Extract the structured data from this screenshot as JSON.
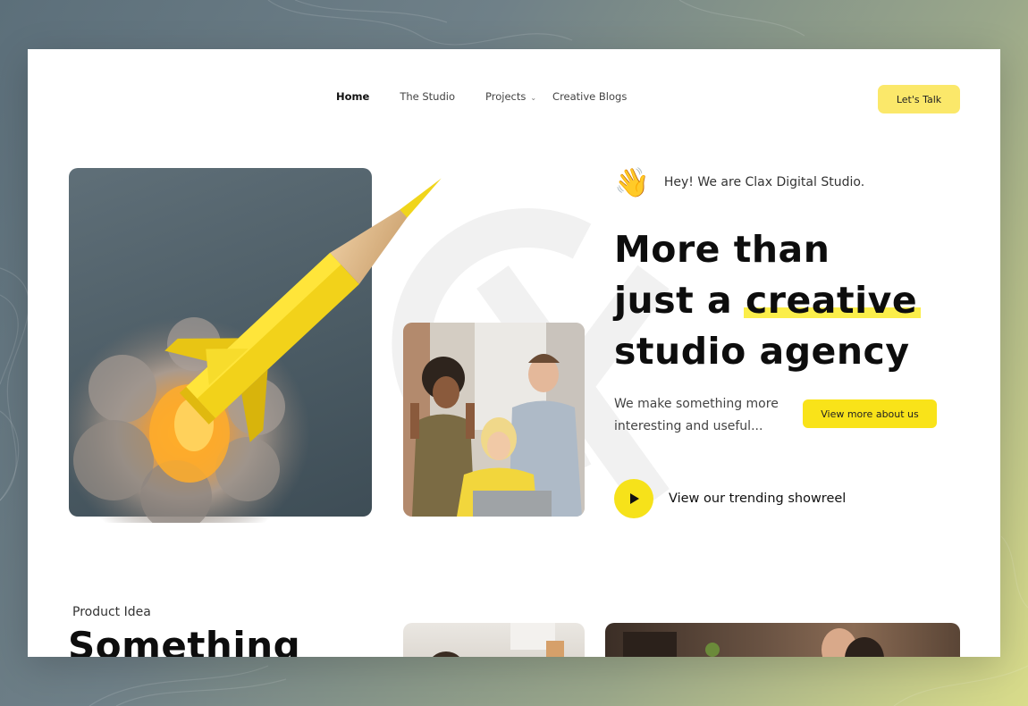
{
  "nav": {
    "items": [
      {
        "label": "Home",
        "active": true
      },
      {
        "label": "The Studio",
        "active": false
      },
      {
        "label": "Projects",
        "active": false,
        "has_dropdown": true
      },
      {
        "label": "Creative Blogs",
        "active": false
      }
    ],
    "cta_label": "Let's Talk"
  },
  "hero": {
    "greeting": "Hey! We are Clax Digital Studio.",
    "greeting_icon": "waving-hand-icon",
    "headline_line1": "More than",
    "headline_line2_pre": "just a ",
    "headline_line2_highlight": "creative",
    "headline_line3": "studio agency",
    "subtitle": "We make something more interesting and useful...",
    "more_button_label": "View more about us",
    "showreel_label": "View our trending showreel",
    "showreel_icon": "play-icon"
  },
  "section": {
    "label": "Product Idea",
    "title": "Something"
  },
  "colors": {
    "accent": "#f9e319",
    "accent_soft": "#fbe86a",
    "text": "#0d0d0d"
  }
}
